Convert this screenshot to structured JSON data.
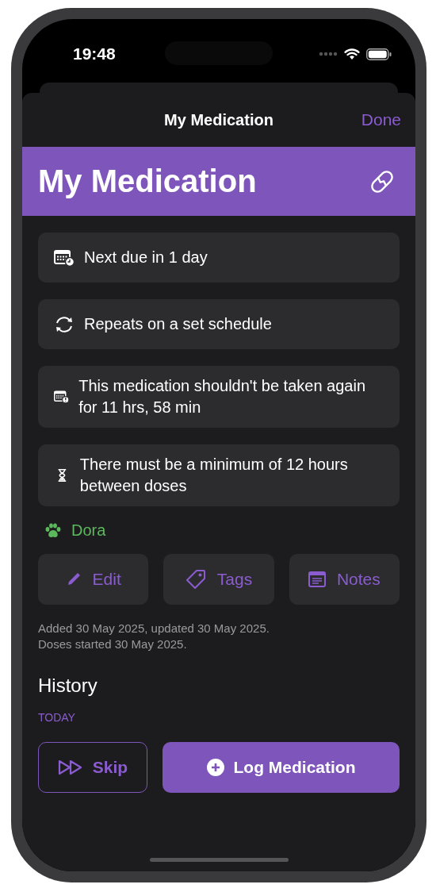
{
  "status_bar": {
    "time": "19:48"
  },
  "nav": {
    "title": "My Medication",
    "done": "Done"
  },
  "header": {
    "title": "My Medication"
  },
  "info_cards": [
    {
      "kind": "due",
      "text": "Next due in 1 day"
    },
    {
      "kind": "repeat",
      "text": "Repeats on a set schedule"
    },
    {
      "kind": "warning",
      "text": "This medication shouldn't be taken again for 11 hrs, 58 min"
    },
    {
      "kind": "interval",
      "text": "There must be a minimum of 12 hours between doses"
    }
  ],
  "pet": {
    "name": "Dora"
  },
  "actions": [
    {
      "kind": "edit",
      "label": "Edit"
    },
    {
      "kind": "tags",
      "label": "Tags"
    },
    {
      "kind": "notes",
      "label": "Notes"
    }
  ],
  "meta": [
    "Added 30 May 2025, updated 30 May 2025.",
    "Doses started 30 May 2025."
  ],
  "history": {
    "title": "History",
    "section": "TODAY"
  },
  "bottom_buttons": [
    {
      "kind": "skip",
      "label": "Skip"
    },
    {
      "kind": "log",
      "label": "Log Medication"
    }
  ]
}
